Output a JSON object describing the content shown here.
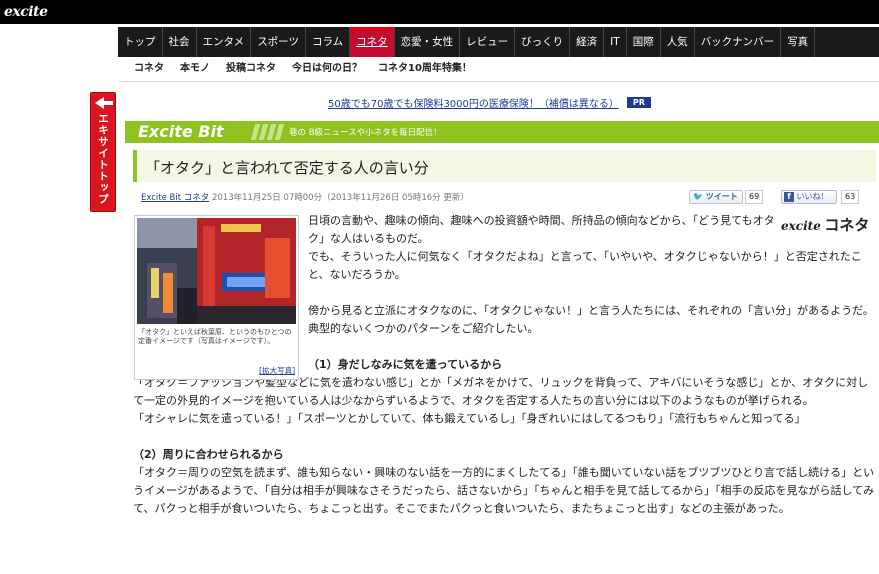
{
  "header": {
    "logo": "excite"
  },
  "nav": {
    "items": [
      "トップ",
      "社会",
      "エンタメ",
      "スポーツ",
      "コラム",
      "コネタ",
      "恋愛・女性",
      "レビュー",
      "びっくり",
      "経済",
      "IT",
      "国際",
      "人気",
      "バックナンバー",
      "写真"
    ],
    "active_index": 5
  },
  "subnav": {
    "items": [
      "コネタ",
      "本モノ",
      "投稿コネタ",
      "今日は何の日？",
      "コネタ10周年特集！"
    ]
  },
  "side_tab": {
    "label": "エキサイトトップ"
  },
  "ad": {
    "link": "50歳でも70歳でも保険料3000円の医療保険！（補償は異なる）",
    "badge": "PR"
  },
  "section": {
    "title": "Excite Bit",
    "tagline": "巷の B級ニュースや小ネタを毎日配信！"
  },
  "article": {
    "title": "「オタク」と言われて否定する人の言い分",
    "source_link": "Excite Bit コネタ",
    "date": "2013年11月25日 07時00分（2013年11月26日 05時16分 更新）",
    "tweet_label": "ツイート",
    "tweet_count": "69",
    "like_label": "いいね！",
    "like_count": "63",
    "photo_caption": "「オタク」といえば秋葉原、というのもひとつの定番イメージです（写真はイメージです）。",
    "photo_enlarge": "[拡大写真]",
    "brand_excite": "excite",
    "brand_konta": "コネタ",
    "paragraphs": [
      "日頃の言動や、趣味の傾向、趣味への投資額や時間、所持品の傾向などから、「どう見てもオタク」な人はいるものだ。",
      "でも、そういった人に何気なく「オタクだよね」と言って、「いやいや、オタクじゃないから！」と否定されたこと、ないだろうか。",
      "傍から見ると立派にオタクなのに、「オタクじゃない！」と言う人たちには、それぞれの「言い分」があるようだ。典型的ないくつかのパターンをご紹介したい。"
    ],
    "section1": {
      "heading": "（1）身だしなみに気を遣っているから",
      "text": "「オタク＝ファッションや髪型などに気を遣わない感じ」とか「メガネをかけて、リュックを背負って、アキバにいそうな感じ」とか、オタクに対して一定の外見的イメージを抱いている人は少なからずいるようで、オタクを否定する人たちの言い分には以下のようなものが挙げられる。",
      "quote": "「オシャレに気を遣っている！」「スポーツとかしていて、体も鍛えているし」「身ぎれいにはしてるつもり」「流行もちゃんと知ってる」"
    },
    "section2": {
      "heading": "（2）周りに合わせられるから",
      "text": "「オタク＝周りの空気を読まず、誰も知らない・興味のない話を一方的にまくしたてる」「誰も聞いていない話をブツブツひとり言で話し続ける」というイメージがあるようで、「自分は相手が興味なさそうだったら、話さないから」「ちゃんと相手を見て話してるから」「相手の反応を見ながら話してみて、パクっと相手が食いついたら、ちょこっと出す。そこでまたパクっと食いついたら、またちょこっと出す」などの主張があった。"
    }
  },
  "colors": {
    "nav_bg": "#1a1a1a",
    "nav_active": "#c40d2e",
    "section_green": "#8dc21f",
    "link_blue": "#1d3b95",
    "side_tab_red": "#d9151e"
  }
}
